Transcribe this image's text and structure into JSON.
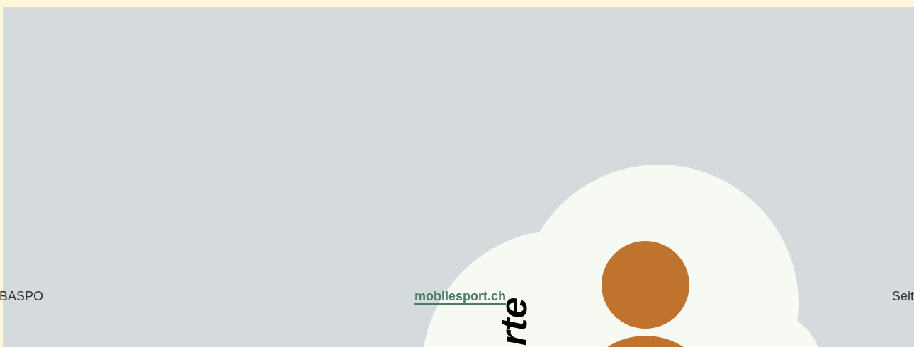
{
  "footer": {
    "left": "BASPO",
    "link": "mobilesport.ch",
    "right": "Seit"
  },
  "illustration": {
    "caption": "rte"
  }
}
